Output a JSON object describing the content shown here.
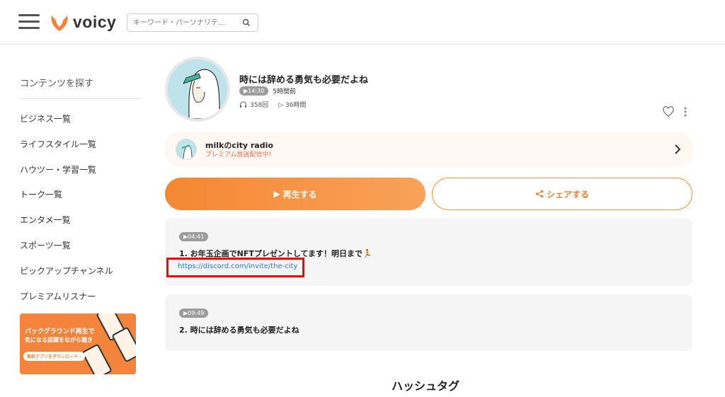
{
  "header": {
    "logo_text": "voicy",
    "search_placeholder": "キーワード・パーソナリテ..."
  },
  "sidebar": {
    "title": "コンテンツを探す",
    "items": [
      {
        "label": "ビジネス一覧"
      },
      {
        "label": "ライフスタイル一覧"
      },
      {
        "label": "ハウツー・学習一覧"
      },
      {
        "label": "トーク一覧"
      },
      {
        "label": "エンタメ一覧"
      },
      {
        "label": "スポーツ一覧"
      },
      {
        "label": "ピックアップチャンネル"
      },
      {
        "label": "プレミアムリスナー"
      }
    ],
    "promo": {
      "line1": "バックグラウンド再生で",
      "line2": "気になる話題をながら聴き",
      "button": "無料アプリをダウンロード ›"
    }
  },
  "episode": {
    "title": "時には辞める勇気も必要だよね",
    "duration": "▶14:30",
    "posted": "5時間前",
    "plays": "358回",
    "listen_time": "▷ 36時間"
  },
  "channel": {
    "name": "milkのcity radio",
    "status": "プレミアム放送配信中！"
  },
  "actions": {
    "play_label": "再生する",
    "share_label": "シェアする"
  },
  "chapters": [
    {
      "time": "▶04:41",
      "title": "1. お年玉企画でNFTプレゼントしてます！明日まで🏃",
      "link": "https://discord.com/invite/the-city"
    },
    {
      "time": "▶09:49",
      "title": "2. 時には辞める勇気も必要だよね"
    }
  ],
  "hashtag_section": {
    "title": "ハッシュタグ"
  },
  "colors": {
    "brand_orange": "#f4843b",
    "highlight_red": "#ff0000",
    "link_blue": "#2a7ae0"
  }
}
